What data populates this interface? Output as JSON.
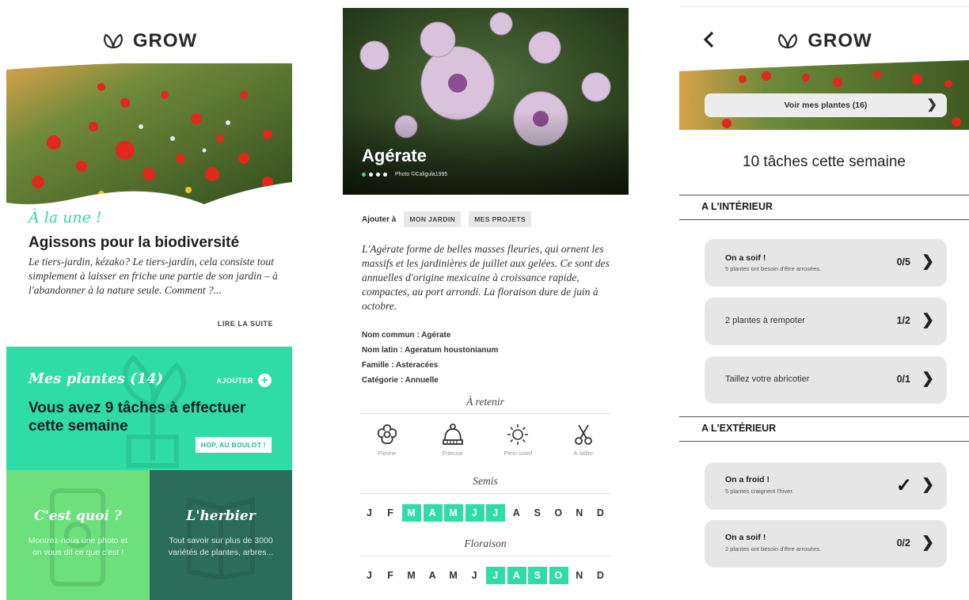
{
  "brand": {
    "name": "GROW",
    "logo_icon": "leaf-logo-icon"
  },
  "colors": {
    "mint": "#2fdca6",
    "green": "#6de07d",
    "dark_green": "#2c6c5b"
  },
  "screen1": {
    "kicker": "À la une !",
    "headline": "Agissons pour la biodiversité",
    "excerpt": "Le tiers-jardin, kézako? Le tiers-jardin, cela consiste tout simplement à laisser en friche une partie de son jardin – à l'abandonner à la nature seule. Comment ?...",
    "read_more": "LIRE LA SUITE",
    "plants_title": "Mes plantes (14)",
    "add_label": "AJOUTER",
    "tasks_text": "Vous avez 9 tâches à effectuer cette semaine",
    "go_button": "HOP, AU BOULOT !",
    "tile_left": {
      "title": "C'est quoi ?",
      "text": "Montrez-nous une photo et on vous dit ce que c'est !"
    },
    "tile_right": {
      "title": "L'herbier",
      "text": "Tout savoir sur plus de 3000 variétés de plantes, arbres..."
    }
  },
  "screen2": {
    "plant_name": "Agérate",
    "photo_credit": "Photo ©Caligula1995",
    "carousel": {
      "count": 4,
      "active": 1
    },
    "add_to_label": "Ajouter à",
    "chip_garden": "MON JARDIN",
    "chip_projects": "MES PROJETS",
    "description": "L'Agérate forme de belles masses fleuries, qui ornent les massifs et les jardinières de juillet aux gelées. Ce sont des annuelles d'origine mexicaine à croissance rapide, compactes, au port arrondi. La floraison dure de juin à octobre.",
    "facts": [
      "Nom commun : Agérate",
      "Nom latin : Ageratum houstonianum",
      "Famille : Asteracées",
      "Catégorie : Annuelle"
    ],
    "retain_title": "À retenir",
    "attributes": [
      {
        "icon": "flower-icon",
        "label": "Fleurie"
      },
      {
        "icon": "beanie-icon",
        "label": "Frileuse"
      },
      {
        "icon": "sun-icon",
        "label": "Plein soleil"
      },
      {
        "icon": "scissors-icon",
        "label": "À tailler"
      }
    ],
    "sowing_title": "Semis",
    "bloom_title": "Floraison",
    "month_letters": [
      "J",
      "F",
      "M",
      "A",
      "M",
      "J",
      "J",
      "A",
      "S",
      "O",
      "N",
      "D"
    ],
    "sowing_months": [
      2,
      3,
      4,
      5,
      6
    ],
    "bloom_months": [
      6,
      7,
      8,
      9
    ]
  },
  "screen3": {
    "back_icon": "chevron-left-icon",
    "view_plants": "Voir mes plantes (16)",
    "week_count": "10 tâches cette semaine",
    "section_inside": "A L'INTÉRIEUR",
    "section_outside": "A L'EXTÉRIEUR",
    "tasks_inside": [
      {
        "title": "On a soif !",
        "sub": "5 plantes ont besoin d'être arrosées.",
        "count": "0/5"
      },
      {
        "title": "2 plantes à rempoter",
        "count": "1/2"
      },
      {
        "title": "Taillez votre abricotier",
        "count": "0/1"
      }
    ],
    "tasks_outside": [
      {
        "title": "On a froid !",
        "sub": "5 plantes craignent l'hiver.",
        "check": "✓"
      },
      {
        "title": "On a soif !",
        "sub": "2 plantes ont besoin d'être arrosées.",
        "count": "0/2"
      }
    ]
  }
}
